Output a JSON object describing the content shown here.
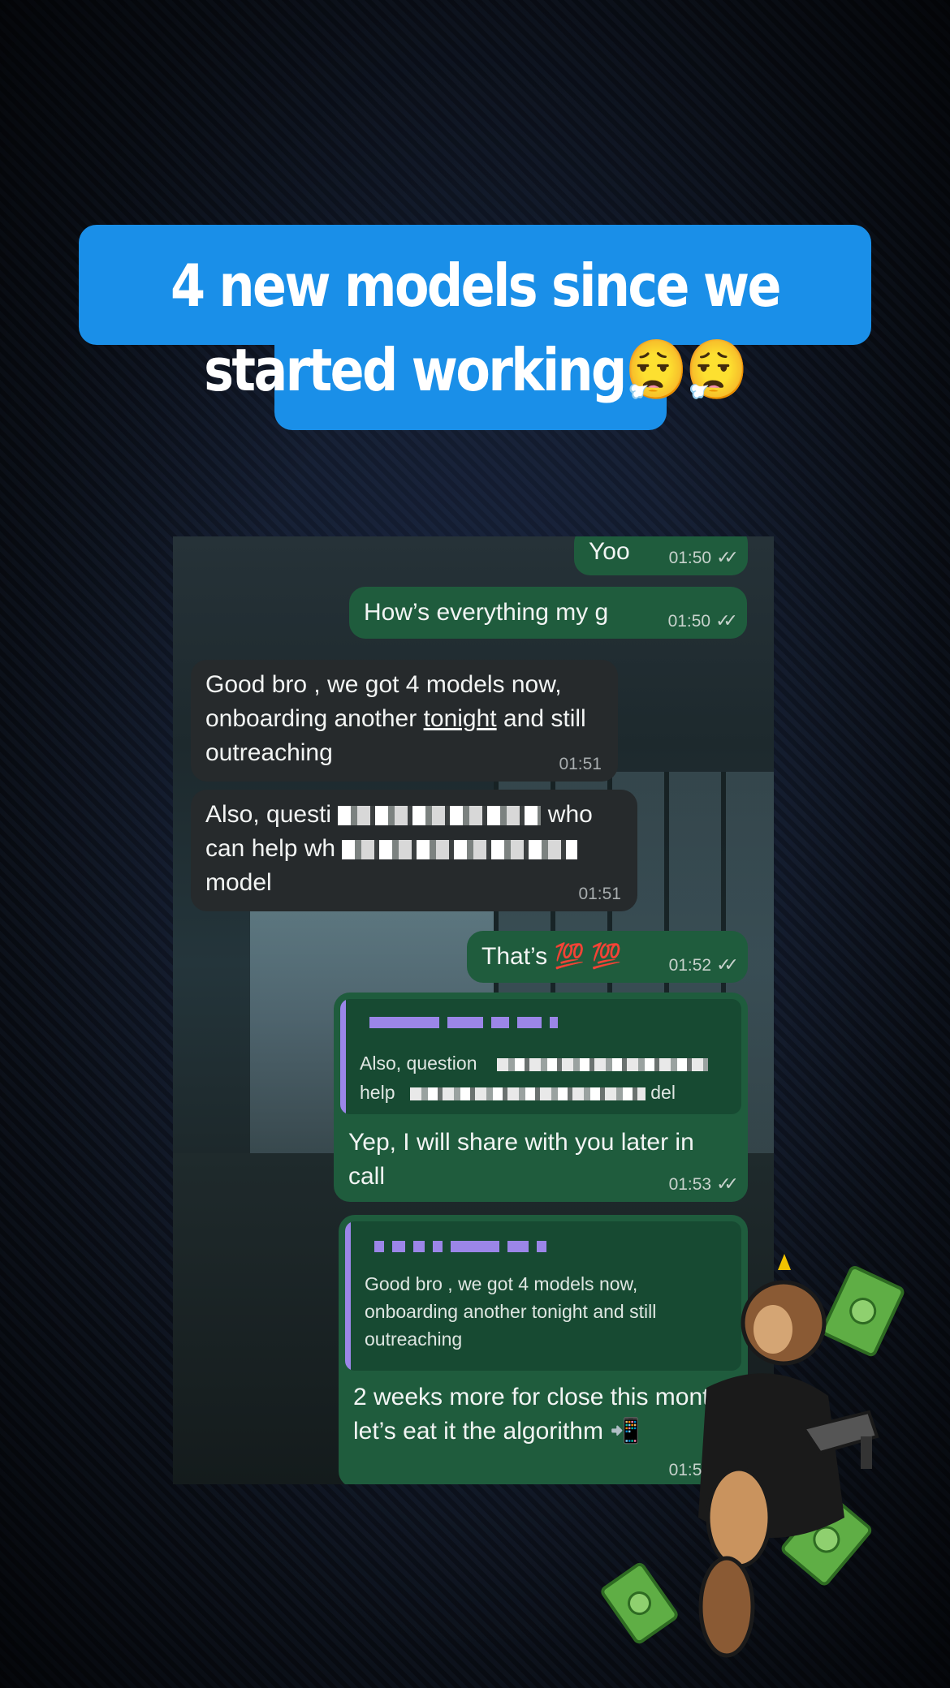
{
  "caption": {
    "text": "4 new models since we started working😮‍💨😮‍💨"
  },
  "messages": [
    {
      "direction": "outgoing",
      "text": "Yoo",
      "time": "01:50",
      "status": "read"
    },
    {
      "direction": "outgoing",
      "text": "How’s everything my g",
      "time": "01:50",
      "status": "read"
    },
    {
      "direction": "incoming",
      "text_parts": [
        "Good bro , we got 4 models now, onboarding another ",
        "tonight",
        " and still outreaching"
      ],
      "time": "01:51"
    },
    {
      "direction": "incoming",
      "text_parts": [
        "Also, questi",
        "who",
        "can help wh",
        "model"
      ],
      "time": "01:51"
    },
    {
      "direction": "outgoing",
      "text": "That’s 💯 💯",
      "time": "01:52",
      "status": "read"
    },
    {
      "direction": "outgoing",
      "quote": {
        "line1": "Also, question",
        "line2_start": "help",
        "line2_end": "del"
      },
      "text": "Yep, I will share with you later in call",
      "time": "01:53",
      "status": "read"
    },
    {
      "direction": "outgoing",
      "quote": {
        "text": "Good bro , we got 4 models now, onboarding another tonight and still outreaching"
      },
      "text": "2 weeks more for close this month , let’s eat it the algorithm 📲",
      "time": "01:55",
      "status": "read"
    }
  ],
  "icons": {
    "read_ticks": "double-check-icon",
    "sticker": "monkey-money-sticker"
  },
  "colors": {
    "caption_bg": "#1a8fe8",
    "outgoing_bubble": "#1f5c3d",
    "incoming_bubble": "#262a2c",
    "quote_accent": "#9b86e8"
  }
}
